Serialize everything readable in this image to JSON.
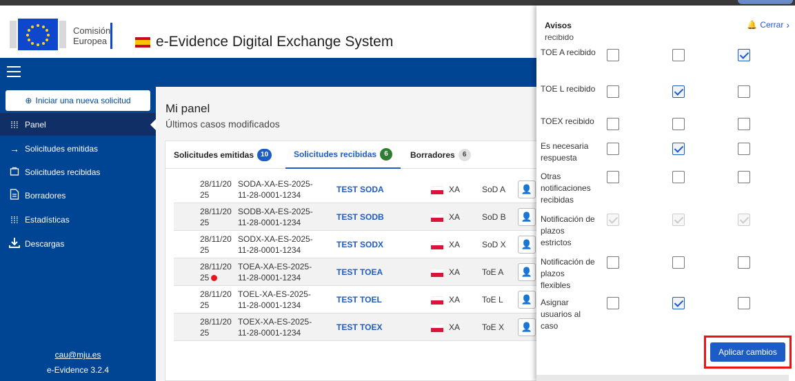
{
  "header": {
    "logo_line1": "Comisión",
    "logo_line2": "Europea",
    "app_title": "e-Evidence Digital Exchange System"
  },
  "sidebar": {
    "new_request": "Iniciar una nueva solicitud",
    "items": [
      {
        "label": "Panel",
        "icon": "grid-icon",
        "active": true
      },
      {
        "label": "Solicitudes emitidas",
        "icon": "arrow-right-icon"
      },
      {
        "label": "Solicitudes recibidas",
        "icon": "bag-icon"
      },
      {
        "label": "Borradores",
        "icon": "document-icon"
      },
      {
        "label": "Estadísticas",
        "icon": "grid-icon"
      },
      {
        "label": "Descargas",
        "icon": "download-icon"
      }
    ],
    "footer_email": "cau@mju.es",
    "footer_version": "e-Evidence 3.2.4"
  },
  "main": {
    "title": "Mi panel",
    "subtitle": "Últimos casos modificados",
    "tabs": [
      {
        "label": "Solicitudes emitidas",
        "count": "10",
        "color": "#1d5bc7"
      },
      {
        "label": "Solicitudes recibidas",
        "count": "6",
        "color": "#2e7d32"
      },
      {
        "label": "Borradores",
        "count": "6",
        "color": "#e0e0e0"
      }
    ],
    "rows": [
      {
        "date1": "28/11/20",
        "date2": "25",
        "code1": "SODA-XA-ES-2025-",
        "code2": "11-28-0001-1234",
        "name": "TEST SODA",
        "cc": "XA",
        "type": "SoD A"
      },
      {
        "date1": "28/11/20",
        "date2": "25",
        "code1": "SODB-XA-ES-2025-",
        "code2": "11-28-0001-1234",
        "name": "TEST SODB",
        "cc": "XA",
        "type": "SoD B"
      },
      {
        "date1": "28/11/20",
        "date2": "25",
        "code1": "SODX-XA-ES-2025-",
        "code2": "11-28-0001-1234",
        "name": "TEST SODX",
        "cc": "XA",
        "type": "SoD X"
      },
      {
        "date1": "28/11/20",
        "date2": "25",
        "code1": "TOEA-XA-ES-2025-",
        "code2": "11-28-0001-1234",
        "name": "TEST TOEA",
        "cc": "XA",
        "type": "ToE A"
      },
      {
        "date1": "28/11/20",
        "date2": "25",
        "code1": "TOEL-XA-ES-2025-",
        "code2": "11-28-0001-1234",
        "name": "TEST TOEL",
        "cc": "XA",
        "type": "ToE L"
      },
      {
        "date1": "28/11/20",
        "date2": "25",
        "code1": "TOEX-XA-ES-2025-",
        "code2": "11-28-0001-1234",
        "name": "TEST TOEX",
        "cc": "XA",
        "type": "ToE X"
      }
    ]
  },
  "notifications": {
    "title": "Avisos",
    "close_label": "Cerrar",
    "cut_text": "recibido",
    "rows": [
      {
        "label": "TOE A recibido",
        "checks": [
          "off",
          "off",
          "on"
        ]
      },
      {
        "label": "TOE L recibido",
        "checks": [
          "off",
          "on",
          "off"
        ]
      },
      {
        "label": "TOEX recibido",
        "checks": [
          "off",
          "off",
          "off"
        ]
      },
      {
        "label": "Es necesaria respuesta",
        "checks": [
          "off",
          "on",
          "off"
        ]
      },
      {
        "label": "Otras notificaciones recibidas",
        "checks": [
          "off",
          "off",
          "off"
        ]
      },
      {
        "label": "Notificación de plazos estrictos",
        "checks": [
          "disabled",
          "disabled",
          "disabled"
        ]
      },
      {
        "label": "Notificación de plazos flexibles",
        "checks": [
          "off",
          "off",
          "off"
        ]
      },
      {
        "label": "Asignar usuarios al caso",
        "checks": [
          "off",
          "on",
          "off"
        ]
      }
    ],
    "apply_label": "Aplicar cambios"
  },
  "colors": {
    "primary_blue": "#004494",
    "link_blue": "#1d5bc7",
    "highlight_red": "#e11111"
  }
}
